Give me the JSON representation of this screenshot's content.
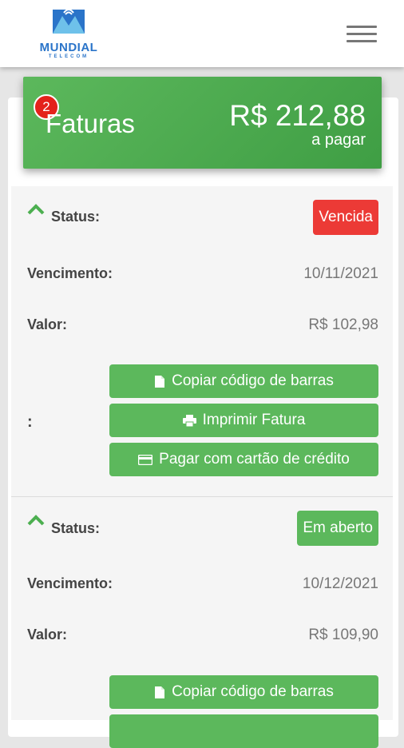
{
  "brand": {
    "name": "MUNDIAL",
    "sub": "TELECOM",
    "primary_color": "#2a74c9"
  },
  "summary": {
    "badge_count": "2",
    "title": "Faturas",
    "amount": "R$ 212,88",
    "amount_caption": "a pagar",
    "color": "#4caf50"
  },
  "invoices": [
    {
      "status_label": "Status:",
      "status": "Vencida",
      "status_color": "#ec3a36",
      "due_label": "Vencimento:",
      "due_date": "10/11/2021",
      "value_label": "Valor:",
      "value": "R$ 102,98",
      "colon": ":",
      "actions": {
        "copy": "Copiar código de barras",
        "print": "Imprimir Fatura",
        "card": "Pagar com cartão de crédito"
      }
    },
    {
      "status_label": "Status:",
      "status": "Em aberto",
      "status_color": "#5cb85c",
      "due_label": "Vencimento:",
      "due_date": "10/12/2021",
      "value_label": "Valor:",
      "value": "R$ 109,90",
      "actions": {
        "copy": "Copiar código de barras"
      }
    }
  ],
  "icons": {
    "menu": "hamburger-icon",
    "collapse": "chevron-up-icon",
    "copy": "document-icon",
    "print": "printer-icon",
    "card": "credit-card-icon"
  }
}
